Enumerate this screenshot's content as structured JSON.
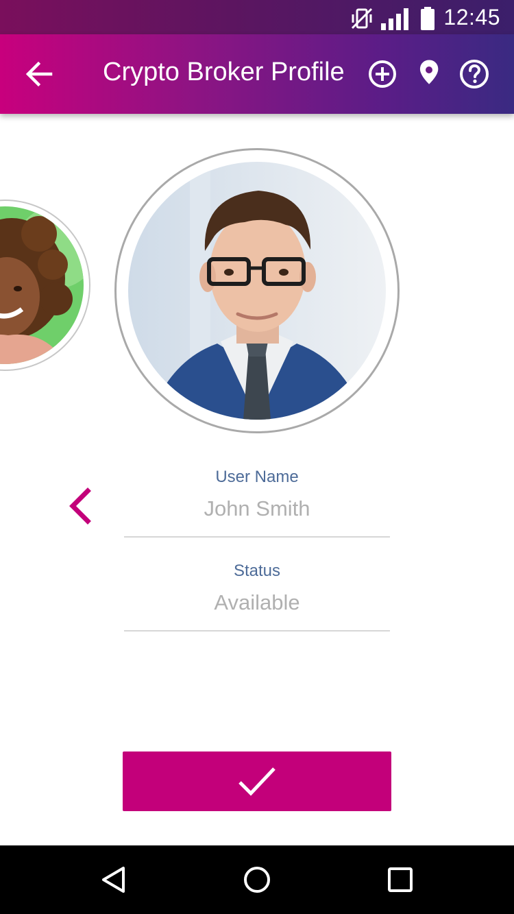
{
  "status_bar": {
    "time": "12:45",
    "icons": [
      "vibrate-off-icon",
      "signal-icon",
      "battery-icon"
    ]
  },
  "toolbar": {
    "title": "Crypto Broker Profile",
    "icons": [
      "back-arrow-icon",
      "add-circle-icon",
      "location-pin-icon",
      "help-circle-icon"
    ]
  },
  "profiles": {
    "current": "man-with-glasses-photo",
    "previous": "woman-curly-hair-photo"
  },
  "form": {
    "username_label": "User Name",
    "username_value": "John Smith",
    "status_label": "Status",
    "status_value": "Available"
  },
  "confirm": {
    "icon": "checkmark-icon"
  },
  "nav_bar": {
    "icons": [
      "nav-back-icon",
      "nav-home-icon",
      "nav-recents-icon"
    ]
  },
  "colors": {
    "accent": "#c3007a",
    "toolbar_start": "#c8007d",
    "toolbar_end": "#3a2a82",
    "label": "#4d6b98",
    "value": "#b0b0b0"
  }
}
